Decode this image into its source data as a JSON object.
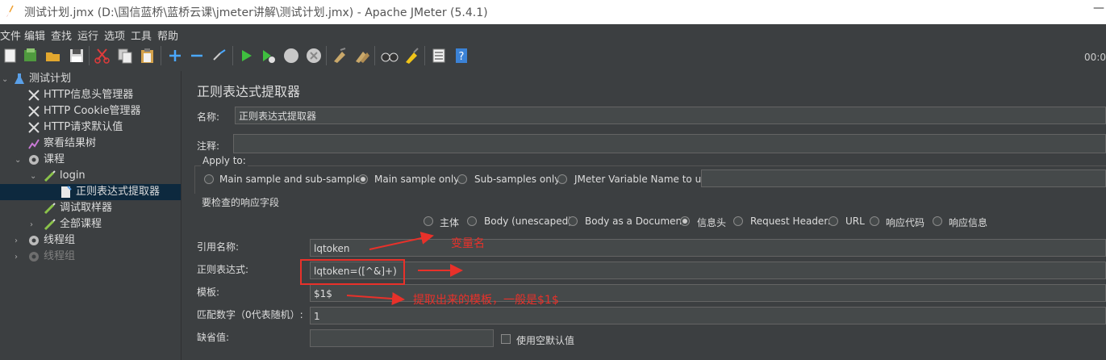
{
  "window": {
    "title": "测试计划.jmx (D:\\国信蓝桥\\蓝桥云课\\jmeter讲解\\测试计划.jmx) - Apache JMeter (5.4.1)",
    "minimize": "—"
  },
  "menu": [
    "文件",
    "编辑",
    "查找",
    "运行",
    "选项",
    "工具",
    "帮助"
  ],
  "toolbar": {
    "timer": "00:0"
  },
  "tree": {
    "items": [
      {
        "label": "测试计划",
        "icon": "flask-icon"
      },
      {
        "label": "HTTP信息头管理器",
        "icon": "wrench-icon"
      },
      {
        "label": "HTTP Cookie管理器",
        "icon": "wrench-icon"
      },
      {
        "label": "HTTP请求默认值",
        "icon": "wrench-icon"
      },
      {
        "label": "察看结果树",
        "icon": "chart-icon"
      },
      {
        "label": "课程",
        "icon": "gear-icon"
      },
      {
        "label": "login",
        "icon": "pipette-icon"
      },
      {
        "label": "正则表达式提取器",
        "icon": "document-icon"
      },
      {
        "label": "调试取样器",
        "icon": "pipette-icon"
      },
      {
        "label": "全部课程",
        "icon": "pipette-icon"
      },
      {
        "label": "线程组",
        "icon": "gear-icon"
      },
      {
        "label": "线程组",
        "icon": "gear-icon"
      }
    ]
  },
  "panel": {
    "title": "正则表达式提取器",
    "name_label": "名称:",
    "name_value": "正则表达式提取器",
    "comment_label": "注释:",
    "comment_value": "",
    "apply_to_label": "Apply to:",
    "apply_options": [
      "Main sample and sub-samples",
      "Main sample only",
      "Sub-samples only",
      "JMeter Variable Name to use"
    ],
    "apply_selected": "Main sample only",
    "field_check_label": "要检查的响应字段",
    "field_options": [
      "主体",
      "Body (unescaped)",
      "Body as a Document",
      "信息头",
      "Request Headers",
      "URL",
      "响应代码",
      "响应信息"
    ],
    "field_selected": "信息头",
    "ref_name_label": "引用名称:",
    "ref_name_value": "lqtoken",
    "regex_label": "正则表达式:",
    "regex_value": "lqtoken=([^&]+)",
    "template_label": "模板:",
    "template_value": "$1$",
    "match_no_label": "匹配数字（0代表随机）:",
    "match_no_value": "1",
    "default_label": "缺省值:",
    "default_value": "",
    "use_empty_label": "使用空默认值"
  },
  "annotations": {
    "var_name": "变量名",
    "template_note": "提取出来的模板，一般是$1$"
  },
  "colors": {
    "annotation": "#e8312a",
    "background": "#3c3f41",
    "selection": "#0d293e"
  }
}
